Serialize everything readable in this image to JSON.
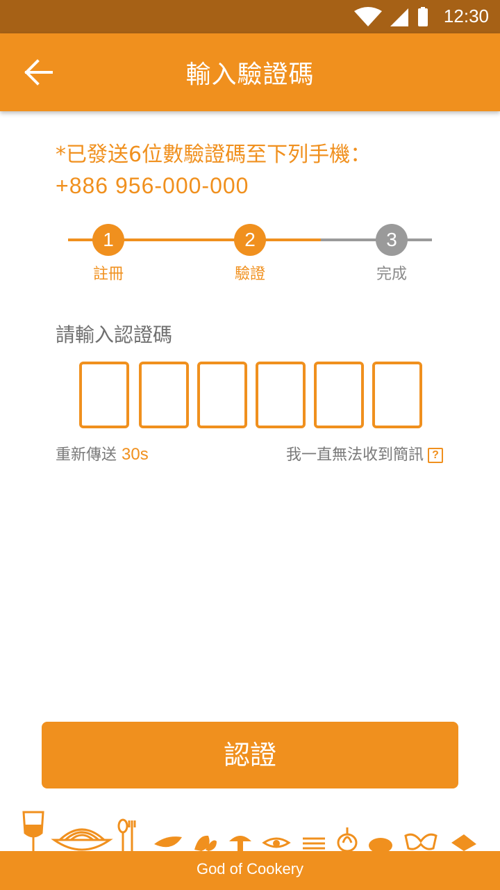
{
  "status_bar": {
    "time": "12:30"
  },
  "app_bar": {
    "title": "輸入驗證碼",
    "back_icon": "arrow-left-icon"
  },
  "notice": {
    "line1": "*已發送6位數驗證碼至下列手機：",
    "phone": "+886 956-000-000"
  },
  "stepper": {
    "current_step": 2,
    "steps": [
      {
        "number": "1",
        "label": "註冊"
      },
      {
        "number": "2",
        "label": "驗證"
      },
      {
        "number": "3",
        "label": "完成"
      }
    ]
  },
  "code_input": {
    "title": "請輸入認證碼",
    "digits": [
      "",
      "",
      "",
      "",
      "",
      ""
    ]
  },
  "resend": {
    "label": "重新傳送",
    "countdown": "30s"
  },
  "no_sms": {
    "label": "我一直無法收到簡訊",
    "help_icon": "?"
  },
  "verify_button": {
    "label": "認證"
  },
  "footer": {
    "text": "God of Cookery"
  },
  "colors": {
    "accent": "#f0901e",
    "status_bar": "#a66116",
    "inactive": "#9a9a9a"
  }
}
